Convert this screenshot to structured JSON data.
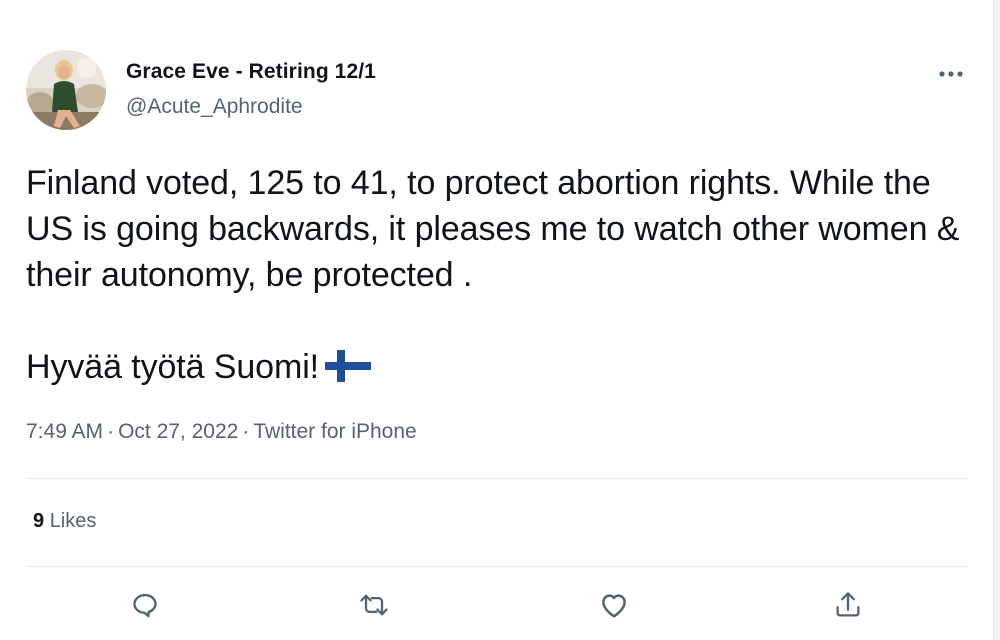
{
  "author": {
    "display_name": "Grace Eve - Retiring 12/1",
    "handle": "@Acute_Aphrodite",
    "avatar_icon": "profile-photo"
  },
  "tweet": {
    "paragraph_1": "Finland voted, 125 to 41, to protect abortion rights. While the US is going backwards, it pleases me to watch other women & their autonomy, be protected .",
    "paragraph_2": "Hyvää työtä Suomi!",
    "flag_icon": "finland-flag-icon"
  },
  "meta": {
    "time": "7:49 AM",
    "separator": "·",
    "date": "Oct 27, 2022",
    "source": "Twitter for iPhone"
  },
  "stats": {
    "likes_count": "9",
    "likes_label": "Likes"
  },
  "actions": {
    "reply_icon": "reply-icon",
    "retweet_icon": "retweet-icon",
    "like_icon": "heart-icon",
    "share_icon": "share-icon"
  },
  "colors": {
    "text": "#0f1419",
    "secondary": "#536471",
    "divider": "#e7ebee",
    "flag_blue": "#1f4e9c"
  }
}
